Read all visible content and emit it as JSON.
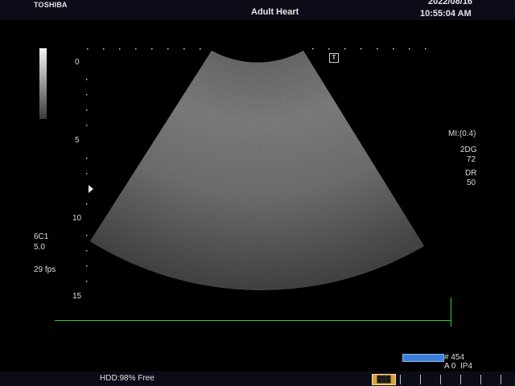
{
  "header": {
    "brand": "TOSHIBA",
    "exam_type": "Adult Heart",
    "date": "2022/08/16",
    "time": "10:55:04 AM"
  },
  "depth_scale": [
    "0",
    "5",
    "10",
    "15"
  ],
  "sector_marker": "T",
  "imaging_params": {
    "mi": "MI:(0.4)",
    "mode": "2DG",
    "gain": "72",
    "dr_label": "DR",
    "dr_value": "50"
  },
  "probe": {
    "name": "6C1",
    "frequency": "5.0",
    "frame_rate": "29 fps"
  },
  "cine": {
    "frame": "# 454",
    "preset": "A 0  IP4",
    "progress": 1.0
  },
  "status": {
    "hdd": "HDD:98% Free"
  },
  "colors": {
    "ecg": "#2ed22e",
    "cine_bar": "#3c7fd8",
    "media_icon": "#d8a23a"
  }
}
